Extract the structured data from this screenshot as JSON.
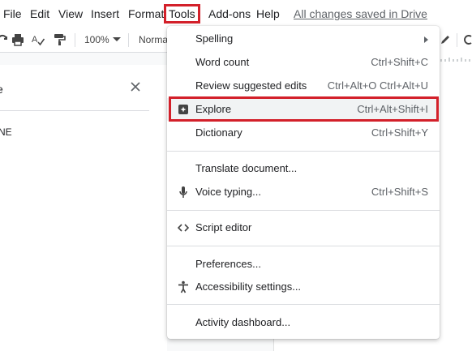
{
  "menubar": {
    "items": [
      "File",
      "Edit",
      "View",
      "Insert",
      "Format",
      "Tools",
      "Add-ons",
      "Help"
    ],
    "saved_status": "All changes saved in Drive"
  },
  "toolbar": {
    "zoom": "100%",
    "style": "Normal"
  },
  "sidepanel": {
    "title": "e",
    "item": "NE"
  },
  "tools_menu": {
    "items": [
      {
        "label": "Spelling",
        "shortcut": "",
        "icon": "",
        "submenu": true
      },
      {
        "label": "Word count",
        "shortcut": "Ctrl+Shift+C",
        "icon": ""
      },
      {
        "label": "Review suggested edits",
        "shortcut": "Ctrl+Alt+O Ctrl+Alt+U",
        "icon": ""
      },
      {
        "label": "Explore",
        "shortcut": "Ctrl+Alt+Shift+I",
        "icon": "explore-icon",
        "highlighted": true
      },
      {
        "label": "Dictionary",
        "shortcut": "Ctrl+Shift+Y",
        "icon": ""
      },
      {
        "label": "Translate document...",
        "shortcut": "",
        "icon": ""
      },
      {
        "label": "Voice typing...",
        "shortcut": "Ctrl+Shift+S",
        "icon": "microphone-icon"
      },
      {
        "label": "Script editor",
        "shortcut": "",
        "icon": "code-icon"
      },
      {
        "label": "Preferences...",
        "shortcut": "",
        "icon": ""
      },
      {
        "label": "Accessibility settings...",
        "shortcut": "",
        "icon": "accessibility-icon"
      },
      {
        "label": "Activity dashboard...",
        "shortcut": "",
        "icon": ""
      }
    ]
  },
  "colors": {
    "highlight_border": "#d3202a",
    "menu_hover": "#f1f3f4",
    "link_gray": "#5f6368"
  }
}
